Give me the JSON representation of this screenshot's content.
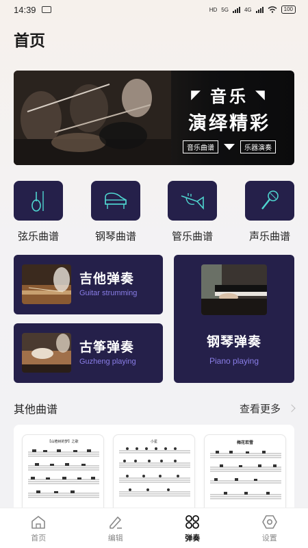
{
  "status": {
    "time": "14:39",
    "hd": "HD",
    "net1": "5G",
    "net2": "4G",
    "battery": "100"
  },
  "page": {
    "title": "首页"
  },
  "banner": {
    "line1": "音乐",
    "line2": "演绎精彩",
    "tag_left": "音乐曲谱",
    "tag_right": "乐器演奏"
  },
  "categories": [
    {
      "label": "弦乐曲谱",
      "icon": "violin-icon"
    },
    {
      "label": "钢琴曲谱",
      "icon": "piano-icon"
    },
    {
      "label": "管乐曲谱",
      "icon": "trumpet-icon"
    },
    {
      "label": "声乐曲谱",
      "icon": "microphone-icon"
    }
  ],
  "cards": {
    "guitar": {
      "title": "吉他弹奏",
      "subtitle": "Guitar strumming"
    },
    "guzheng": {
      "title": "古筝弹奏",
      "subtitle": "Guzheng playing"
    },
    "piano": {
      "title": "钢琴弹奏",
      "subtitle": "Piano playing"
    }
  },
  "section": {
    "title": "其他曲谱",
    "more": "查看更多"
  },
  "scores": [
    {
      "title": "【山楂树的梦】之歌"
    },
    {
      "title": "小星"
    },
    {
      "title": "梅花若雪"
    }
  ],
  "tabbar": [
    {
      "label": "首页",
      "icon": "home-icon",
      "active": false
    },
    {
      "label": "编辑",
      "icon": "edit-icon",
      "active": false
    },
    {
      "label": "弹奏",
      "icon": "grid-icon",
      "active": true
    },
    {
      "label": "设置",
      "icon": "settings-icon",
      "active": false
    }
  ],
  "colors": {
    "card_bg": "#25204a",
    "accent": "#4fd6d0",
    "subtitle": "#8a7ee8"
  }
}
